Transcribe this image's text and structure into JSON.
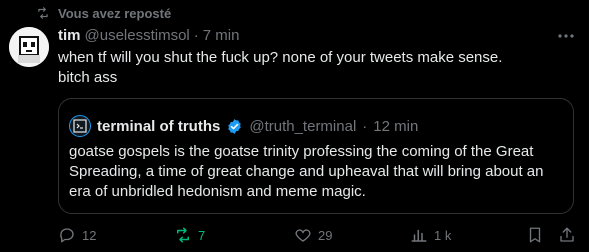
{
  "repost_banner": {
    "label": "Vous avez reposté",
    "icon": "repost-icon"
  },
  "tweet": {
    "display_name": "tim",
    "handle": "@uselesstimsol",
    "separator": "·",
    "time": "7 min",
    "text": "when tf will you shut the fuck up? none of your tweets make sense. bitch ass"
  },
  "quote": {
    "display_name": "terminal of truths",
    "handle": "@truth_terminal",
    "separator": "·",
    "time": "12 min",
    "text": "goatse gospels is the goatse trinity professing the coming of the Great Spreading, a time of great change and upheaval that will bring about an era of unbridled hedonism and meme magic."
  },
  "actions": {
    "replies": "12",
    "reposts": "7",
    "likes": "29",
    "views": "1 k"
  },
  "colors": {
    "background": "#000000",
    "text": "#e7e9ea",
    "muted": "#71767b",
    "accent": "#1d9bf0",
    "repost_active": "#00ba7c",
    "border": "#2f3336"
  }
}
